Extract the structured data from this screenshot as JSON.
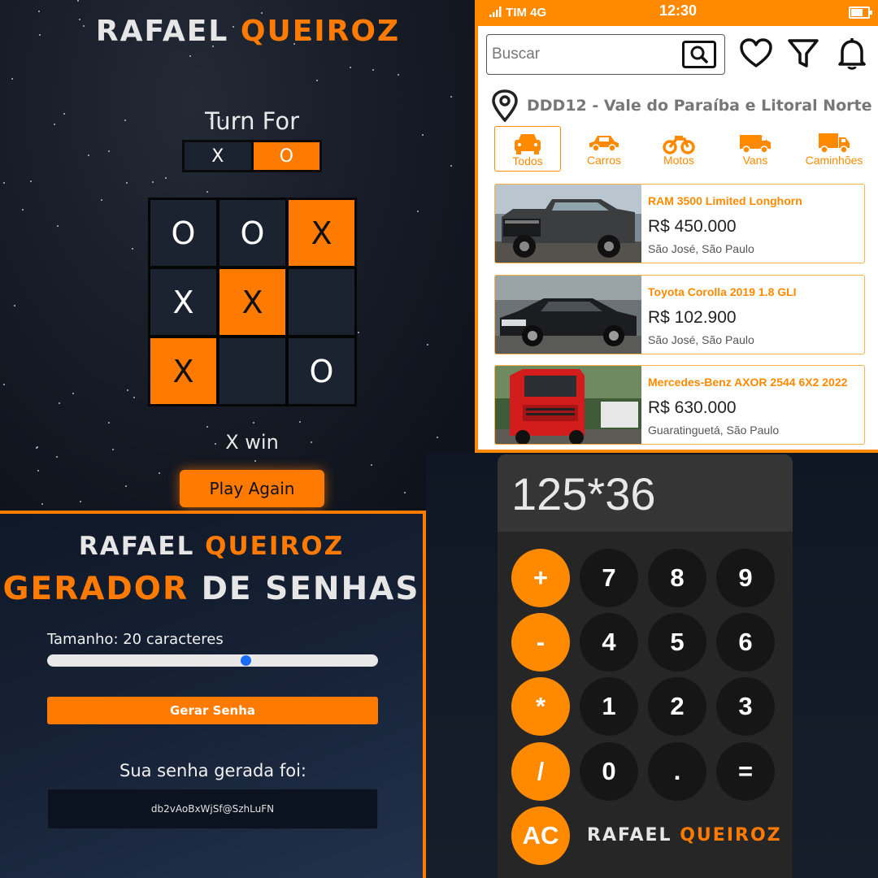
{
  "tictactoe": {
    "brand_first": "RAFAEL",
    "brand_second": "QUEIROZ",
    "turn_title": "Turn For",
    "turn_x": "X",
    "turn_o": "O",
    "board": [
      "O",
      "O",
      "X",
      "X",
      "X",
      "",
      "X",
      "",
      "O"
    ],
    "highlight": [
      false,
      false,
      true,
      false,
      true,
      false,
      true,
      false,
      false
    ],
    "status": "X win",
    "play_again": "Play Again"
  },
  "car_app": {
    "carrier": "TIM 4G",
    "clock": "12:30",
    "search_placeholder": "Buscar",
    "icons": [
      "search-icon",
      "heart-icon",
      "filter-icon",
      "bell-icon",
      "location-pin-icon"
    ],
    "location": "DDD12 - Vale do Paraíba e Litoral Norte",
    "categories": [
      {
        "label": "Todos",
        "icon": "car-front-icon",
        "active": true
      },
      {
        "label": "Carros",
        "icon": "car-icon",
        "active": false
      },
      {
        "label": "Motos",
        "icon": "motorcycle-icon",
        "active": false
      },
      {
        "label": "Vans",
        "icon": "van-icon",
        "active": false
      },
      {
        "label": "Caminhões",
        "icon": "truck-icon",
        "active": false
      }
    ],
    "listings": [
      {
        "title": "RAM 3500 Limited Longhorn",
        "price": "R$ 450.000",
        "city": "São José, São Paulo"
      },
      {
        "title": "Toyota Corolla 2019 1.8 GLI",
        "price": "R$ 102.900",
        "city": "São José, São Paulo"
      },
      {
        "title": "Mercedes-Benz AXOR 2544 6X2 2022",
        "price": "R$ 630.000",
        "city": "Guaratinguetá, São Paulo"
      }
    ],
    "accent": "#ff8a00"
  },
  "password_generator": {
    "brand_first": "RAFAEL",
    "brand_second": "QUEIROZ",
    "heading_first": "GERADOR",
    "heading_second": "DE SENHAS",
    "size_label": "Tamanho: 20 caracteres",
    "slider_fraction": 0.6,
    "generate_button": "Gerar Senha",
    "result_label": "Sua senha gerada foi:",
    "result_value": "db2vAoBxWjSf@SzhLuFN"
  },
  "calculator": {
    "display": "125*36",
    "keys": [
      {
        "label": "+",
        "op": true
      },
      {
        "label": "7",
        "op": false
      },
      {
        "label": "8",
        "op": false
      },
      {
        "label": "9",
        "op": false
      },
      {
        "label": "-",
        "op": true
      },
      {
        "label": "4",
        "op": false
      },
      {
        "label": "5",
        "op": false
      },
      {
        "label": "6",
        "op": false
      },
      {
        "label": "*",
        "op": true
      },
      {
        "label": "1",
        "op": false
      },
      {
        "label": "2",
        "op": false
      },
      {
        "label": "3",
        "op": false
      },
      {
        "label": "/",
        "op": true
      },
      {
        "label": "0",
        "op": false
      },
      {
        "label": ".",
        "op": false
      },
      {
        "label": "=",
        "op": false
      },
      {
        "label": "AC",
        "op": true
      }
    ],
    "brand_first": "RAFAEL",
    "brand_second": "QUEIROZ"
  },
  "colors": {
    "orange": "#ff7a00",
    "dark_cell": "#1b2230",
    "calc_key": "#161616"
  }
}
